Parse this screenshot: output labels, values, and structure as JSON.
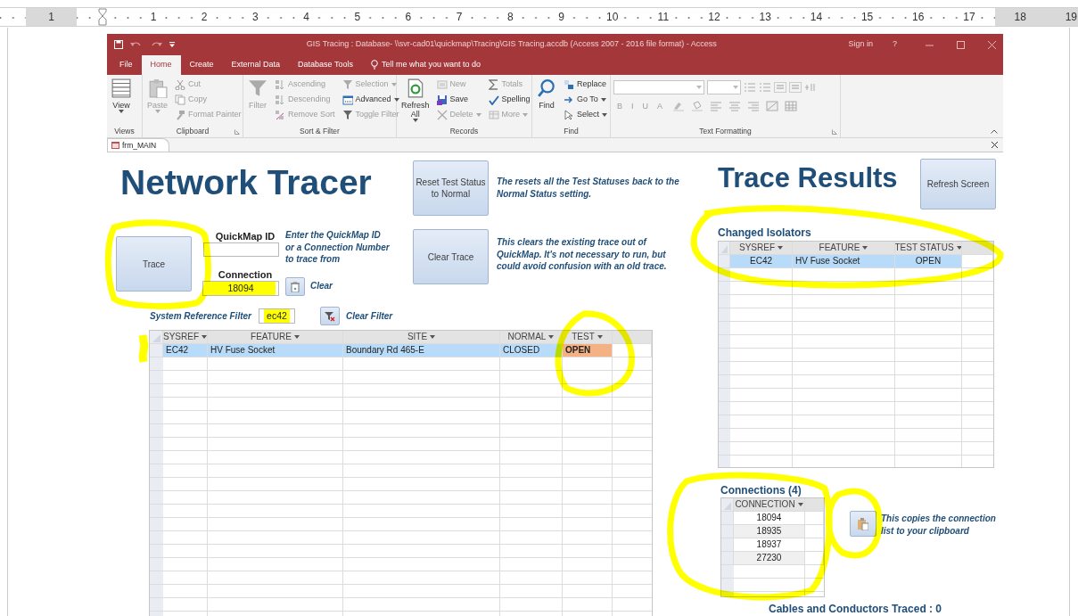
{
  "ruler": [
    {
      "label": "1",
      "margin": true
    },
    {
      "margin": false
    },
    {
      "label": "1",
      "margin": false
    },
    {
      "label": "2",
      "margin": false
    },
    {
      "label": "3",
      "margin": false
    },
    {
      "label": "4",
      "margin": false
    },
    {
      "label": "5",
      "margin": false
    },
    {
      "label": "6",
      "margin": false
    },
    {
      "label": "7",
      "margin": false
    },
    {
      "label": "8",
      "margin": false
    },
    {
      "label": "9",
      "margin": false
    },
    {
      "label": "10",
      "margin": false
    },
    {
      "label": "11",
      "margin": false
    },
    {
      "label": "12",
      "margin": false
    },
    {
      "label": "13",
      "margin": false
    },
    {
      "label": "14",
      "margin": false
    },
    {
      "label": "15",
      "margin": false
    },
    {
      "label": "16",
      "margin": false
    },
    {
      "label": "17",
      "margin": false
    },
    {
      "label": "18",
      "margin": true
    },
    {
      "label": "19",
      "margin": true
    }
  ],
  "window": {
    "title": "GIS Tracing : Database- \\\\svr-cad01\\quickmap\\Tracing\\GIS Tracing.accdb (Access 2007 - 2016 file format) - Access",
    "sign_in": "Sign in",
    "help": "?"
  },
  "tabs": [
    {
      "label": "File",
      "selected": false
    },
    {
      "label": "Home",
      "selected": true
    },
    {
      "label": "Create",
      "selected": false
    },
    {
      "label": "External Data",
      "selected": false
    },
    {
      "label": "Database Tools",
      "selected": false
    }
  ],
  "tell_me": "Tell me what you want to do",
  "ribbon_groups": [
    {
      "label": "Views",
      "launcher": false,
      "large": [
        {
          "label": "View",
          "kind": "view",
          "disabled": false,
          "dropdown": true
        }
      ]
    },
    {
      "label": "Clipboard",
      "launcher": true,
      "large": [
        {
          "label": "Paste",
          "kind": "paste",
          "disabled": true,
          "dropdown": true
        }
      ],
      "columns": [
        [
          {
            "label": "Cut",
            "kind": "cut",
            "disabled": true
          },
          {
            "label": "Copy",
            "kind": "copy",
            "disabled": true
          },
          {
            "label": "Format Painter",
            "kind": "painter",
            "disabled": true
          }
        ]
      ]
    },
    {
      "label": "Sort & Filter",
      "launcher": false,
      "large": [
        {
          "label": "Filter",
          "kind": "filter",
          "disabled": true
        }
      ],
      "columns": [
        [
          {
            "label": "Ascending",
            "kind": "ascending",
            "disabled": true
          },
          {
            "label": "Descending",
            "kind": "descending",
            "disabled": true
          },
          {
            "label": "Remove Sort",
            "kind": "unsort",
            "disabled": true
          }
        ],
        [
          {
            "label": "Selection",
            "kind": "selection",
            "disabled": true,
            "dropdown": true
          },
          {
            "label": "Advanced",
            "kind": "advanced",
            "disabled": false,
            "dropdown": true
          },
          {
            "label": "Toggle Filter",
            "kind": "toggle",
            "disabled": true
          }
        ]
      ]
    },
    {
      "label": "Records",
      "launcher": false,
      "large": [
        {
          "label": "Refresh All",
          "kind": "refresh",
          "disabled": false,
          "dropdown": true
        }
      ],
      "columns": [
        [
          {
            "label": "New",
            "kind": "new",
            "disabled": true
          },
          {
            "label": "Save",
            "kind": "save",
            "disabled": false
          },
          {
            "label": "Delete",
            "kind": "delete",
            "disabled": true,
            "dropdown": true
          }
        ],
        [
          {
            "label": "Totals",
            "kind": "totals",
            "disabled": true
          },
          {
            "label": "Spelling",
            "kind": "spelling",
            "disabled": false
          },
          {
            "label": "More",
            "kind": "more",
            "disabled": true,
            "dropdown": true
          }
        ]
      ]
    },
    {
      "label": "Find",
      "launcher": false,
      "large": [
        {
          "label": "Find",
          "kind": "find",
          "disabled": false
        }
      ],
      "columns": [
        [
          {
            "label": "Replace",
            "kind": "replace",
            "disabled": false
          },
          {
            "label": "Go To",
            "kind": "goto",
            "disabled": false,
            "dropdown": true
          },
          {
            "label": "Select",
            "kind": "select",
            "disabled": false,
            "dropdown": true
          }
        ]
      ]
    }
  ],
  "text_formatting": {
    "label": "Text Formatting",
    "launcher": true,
    "letters": [
      "B",
      "I",
      "U",
      "A"
    ]
  },
  "form_tab": {
    "label": "frm_MAIN",
    "selected": true
  },
  "form": {
    "title": "Network Tracer",
    "reset_button": "Reset Test Status to Normal",
    "reset_note": "The resets all the Test Statuses back to the Normal Status setting.",
    "trace_button": "Trace",
    "quickmap_label": "QuickMap ID",
    "trace_note": "Enter the QuickMap ID or a Connection Number to trace from",
    "connection_label": "Connection",
    "connection_field": {
      "value": "18094",
      "highlighted": true
    },
    "clear_label": "Clear",
    "clear_trace_button": "Clear Trace",
    "clear_trace_note": "This clears the existing trace out of QuickMap.  It's not necessary to run, but could avoid confusion with an old trace.",
    "filter_label": "System Reference Filter",
    "filter_field": {
      "value": "ec42",
      "highlighted": true
    },
    "clear_filter_label": "Clear Filter",
    "grid": {
      "columns": [
        "SYSREF",
        "FEATURE",
        "SITE",
        "NORMAL",
        "TEST"
      ],
      "rows": [
        {
          "selected": true,
          "cells": [
            {
              "text": "EC42"
            },
            {
              "text": "HV Fuse Socket"
            },
            {
              "text": "Boundary Rd 465-E"
            },
            {
              "text": "CLOSED"
            },
            {
              "text": "OPEN",
              "color": "#f4b183"
            }
          ]
        }
      ]
    }
  },
  "results": {
    "title": "Trace Results",
    "refresh_button": "Refresh Screen",
    "isolators_label": "Changed Isolators",
    "isolators": {
      "columns": [
        "SYSREF",
        "FEATURE",
        "TEST STATUS"
      ],
      "rows": [
        {
          "selected": true,
          "cells": [
            {
              "text": "EC42"
            },
            {
              "text": "HV Fuse Socket"
            },
            {
              "text": "OPEN"
            }
          ]
        }
      ]
    },
    "connections_label": "Connections (4)",
    "connections": {
      "columns": [
        "CONNECTION"
      ],
      "rows": [
        {
          "cells": [
            {
              "text": "18094"
            }
          ]
        },
        {
          "cells": [
            {
              "text": "18935"
            }
          ]
        },
        {
          "cells": [
            {
              "text": "18937"
            }
          ]
        },
        {
          "cells": [
            {
              "text": "27230"
            }
          ]
        }
      ]
    },
    "copy_note": "This copies the connection list to your clipboard",
    "cables_label": "Cables and Conductors Traced : 0"
  }
}
